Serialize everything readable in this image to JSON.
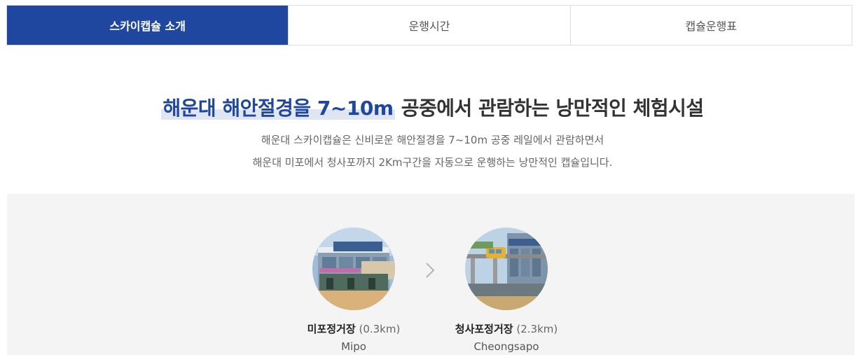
{
  "tabs": [
    {
      "label": "스카이캡슐 소개",
      "active": true
    },
    {
      "label": "운행시간",
      "active": false
    },
    {
      "label": "캡슐운행표",
      "active": false
    }
  ],
  "headline": {
    "highlight": "해운대 해안절경을 7~10m",
    "rest": "공중에서 관람하는 낭만적인 체험시설"
  },
  "description": {
    "line1": "해운대 스카이캡슐은 신비로운 해안절경을 7~10m 공중 레일에서 관람하면서",
    "line2": "해운대 미포에서 청사포까지 2Km구간을 자동으로 운행하는 낭만적인 캡슐입니다."
  },
  "route": {
    "arrow_icon": "chevron-right-icon",
    "stations": [
      {
        "name": "미포정거장",
        "distance": "(0.3km)",
        "english": "Mipo",
        "photo_icon": "station-photo-mipo"
      },
      {
        "name": "청사포정거장",
        "distance": "(2.3km)",
        "english": "Cheongsapo",
        "photo_icon": "station-photo-cheongsapo"
      }
    ]
  },
  "colors": {
    "accent": "#1f47a0",
    "highlight_bg": "#dfe6f2",
    "route_bg": "#f4f4f4"
  }
}
